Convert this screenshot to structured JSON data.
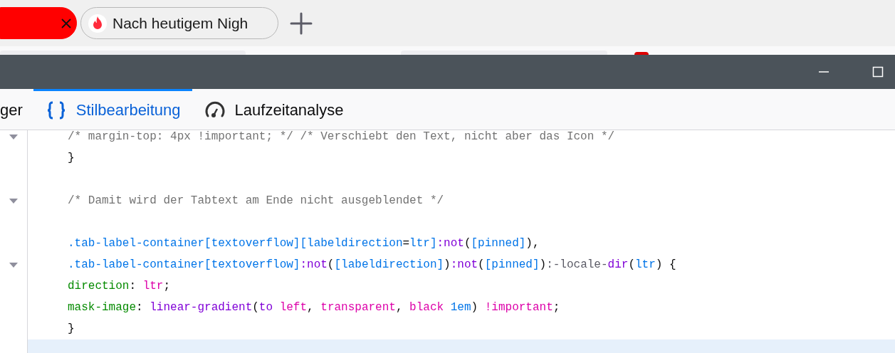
{
  "browser_tabs": [
    {
      "selected": true
    },
    {
      "title": "Nach heutigem Nigh",
      "selected": false
    }
  ],
  "devtools_tabs": [
    {
      "label": "ger",
      "selected": false
    },
    {
      "label": "Stilbearbeitung",
      "selected": true
    },
    {
      "label": "Laufzeitanalyse",
      "selected": false
    }
  ],
  "editor": {
    "lines": [
      {
        "fold": true,
        "current": false,
        "tokens": [
          {
            "kind": "comment",
            "t": "/* margin-top: 4px !important; */ /* Verschiebt den Text, nicht aber das Icon */"
          }
        ]
      },
      {
        "fold": false,
        "current": false,
        "tokens": [
          {
            "kind": "punct",
            "t": "}"
          }
        ]
      },
      {
        "fold": false,
        "current": false
      },
      {
        "fold": true,
        "current": false,
        "tokens": [
          {
            "kind": "comment",
            "t": "/* Damit wird der Tabtext am Ende nicht ausgeblendet */"
          }
        ]
      },
      {
        "fold": false,
        "current": false
      },
      {
        "fold": false,
        "current": false,
        "tokens": [
          {
            "kind": "sel",
            "t": ".tab-label-container[textoverflow][labeldirection"
          },
          {
            "kind": "punct",
            "t": "="
          },
          {
            "kind": "sel",
            "t": "ltr]"
          },
          {
            "kind": "pseudo",
            "t": ":not"
          },
          {
            "kind": "punct",
            "t": "("
          },
          {
            "kind": "sel",
            "t": "[pinned]"
          },
          {
            "kind": "punct",
            "t": "),"
          }
        ]
      },
      {
        "fold": true,
        "current": false,
        "tokens": [
          {
            "kind": "sel",
            "t": ".tab-label-container[textoverflow]"
          },
          {
            "kind": "pseudo",
            "t": ":not"
          },
          {
            "kind": "punct",
            "t": "("
          },
          {
            "kind": "sel",
            "t": "[labeldirection]"
          },
          {
            "kind": "punct",
            "t": ")"
          },
          {
            "kind": "pseudo",
            "t": ":not"
          },
          {
            "kind": "punct",
            "t": "("
          },
          {
            "kind": "sel",
            "t": "[pinned]"
          },
          {
            "kind": "punct",
            "t": ")"
          },
          {
            "kind": "locale",
            "t": ":-locale-"
          },
          {
            "kind": "pseudo",
            "t": "dir"
          },
          {
            "kind": "punct",
            "t": "("
          },
          {
            "kind": "sel",
            "t": "ltr"
          },
          {
            "kind": "punct",
            "t": ") {"
          }
        ]
      },
      {
        "fold": false,
        "current": false,
        "tokens": [
          {
            "kind": "prop",
            "t": "direction"
          },
          {
            "kind": "punct",
            "t": ": "
          },
          {
            "kind": "val",
            "t": "ltr"
          },
          {
            "kind": "punct",
            "t": ";"
          }
        ]
      },
      {
        "fold": false,
        "current": false,
        "tokens": [
          {
            "kind": "prop",
            "t": "mask-image"
          },
          {
            "kind": "punct",
            "t": ": "
          },
          {
            "kind": "fn",
            "t": "linear-gradient"
          },
          {
            "kind": "punct",
            "t": "("
          },
          {
            "kind": "fn",
            "t": "to"
          },
          {
            "kind": "val",
            "t": " left"
          },
          {
            "kind": "punct",
            "t": ", "
          },
          {
            "kind": "val",
            "t": "transparent"
          },
          {
            "kind": "punct",
            "t": ", "
          },
          {
            "kind": "val",
            "t": "black"
          },
          {
            "kind": "num",
            "t": " 1em"
          },
          {
            "kind": "punct",
            "t": ") "
          },
          {
            "kind": "val",
            "t": "!important"
          },
          {
            "kind": "punct",
            "t": ";"
          }
        ]
      },
      {
        "fold": false,
        "current": false,
        "tokens": [
          {
            "kind": "punct",
            "t": "}"
          }
        ]
      },
      {
        "fold": false,
        "current": true
      }
    ]
  }
}
